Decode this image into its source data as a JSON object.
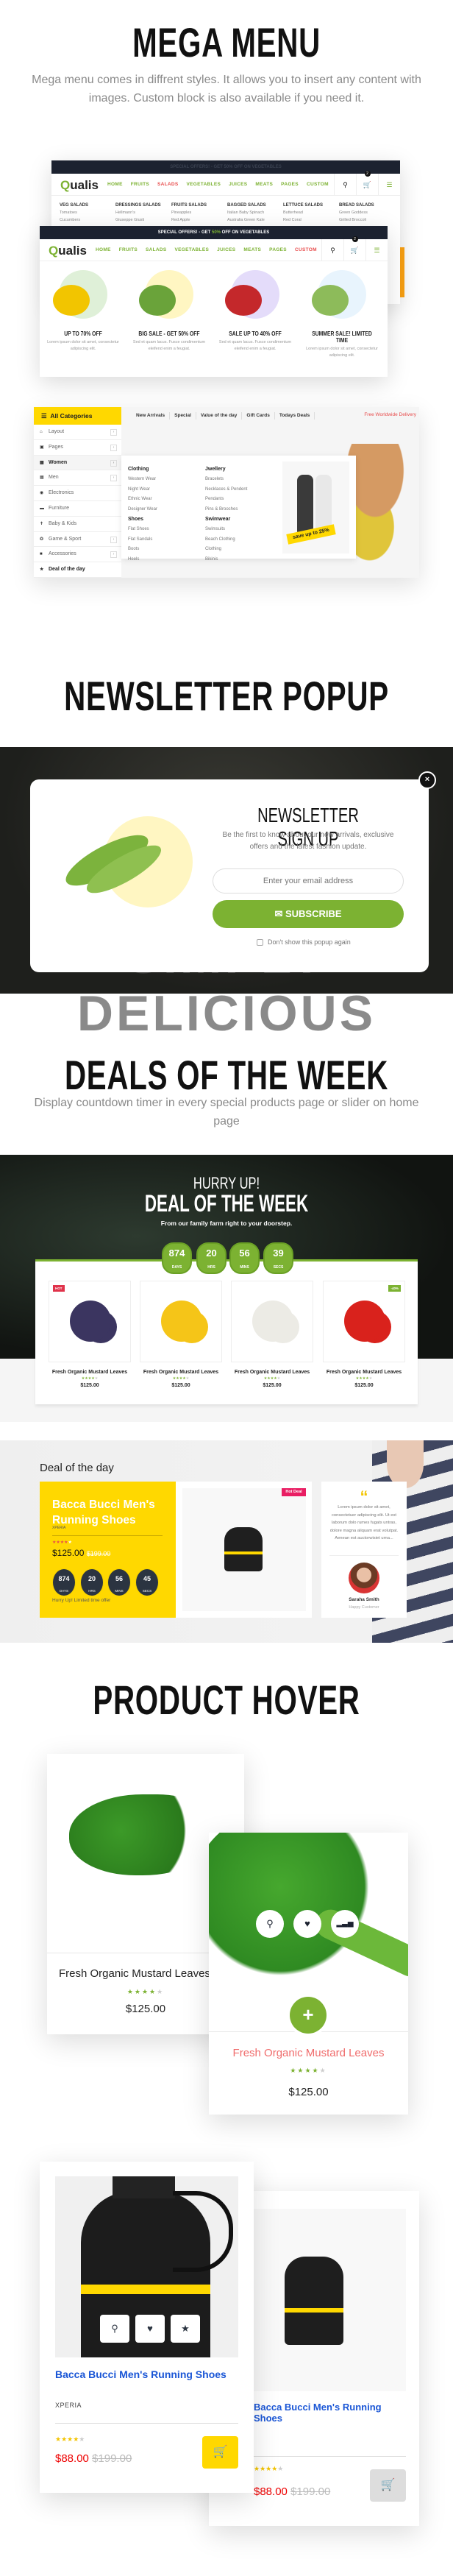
{
  "colors": {
    "accent_green": "#7cb232",
    "dark": "#1c2230",
    "yellow": "#ffd800",
    "red": "#e84c4c",
    "blue": "#1a56d6",
    "pink": "#e91e63"
  },
  "mega_menu": {
    "title": "MEGA MENU",
    "subtitle": "Mega menu comes in diffrent styles. It allows you to insert any content with images. Custom block is also available if you need it.",
    "back_window": {
      "offer_bar": "SPECIAL OFFERS! - GET 50% OFF ON VEGETABLES",
      "logo": "Qualis",
      "nav": [
        "HOME",
        "FRUITS",
        "SALADS",
        "VEGETABLES",
        "JUICES",
        "MEATS",
        "PAGES",
        "CUSTOM"
      ],
      "active_nav": "SALADS",
      "cart_count": "2",
      "submenu": [
        {
          "heading": "VEG SALADS",
          "items": [
            "Tomatoes",
            "Cucumbers"
          ]
        },
        {
          "heading": "DRESSINGS SALADS",
          "items": [
            "Hellmann's",
            "Giuseppe Giusti"
          ]
        },
        {
          "heading": "FRUITS SALADS",
          "items": [
            "Pineapples",
            "Red Apple"
          ]
        },
        {
          "heading": "BAGGED SALADS",
          "items": [
            "Italian Baby Spinach",
            "Australia Green Kale"
          ]
        },
        {
          "heading": "LETTUCE SALADS",
          "items": [
            "Butterhead",
            "Red Coral"
          ]
        },
        {
          "heading": "BREAD SALADS",
          "items": [
            "Green Goddess",
            "Grilled Broccoli"
          ]
        }
      ]
    },
    "front_window": {
      "offer_prefix": "SPECIAL OFFERS! - GET ",
      "offer_highlight": "50%",
      "offer_suffix": " OFF ON VEGETABLES",
      "logo": "Qualis",
      "nav": [
        "HOME",
        "FRUITS",
        "SALADS",
        "VEGETABLES",
        "JUICES",
        "MEATS",
        "PAGES",
        "CUSTOM"
      ],
      "active_nav": "CUSTOM",
      "cart_count": "2",
      "promos": [
        {
          "title": "UP TO 70% OFF",
          "desc": "Lorem ipsum dolor sit amet, consectetur adipiscing elit.",
          "circle": "#dff0d8",
          "fruit": "#f2c500"
        },
        {
          "title": "BIG SALE - GET 50% OFF",
          "desc": "Sed et quam lacus. Fusce condimentum eleifend enim a feugiat.",
          "circle": "#fff6c2",
          "fruit": "#6aa33a"
        },
        {
          "title": "SALE UP TO 40% OFF",
          "desc": "Sed et quam lacus. Fusce condimentum eleifend enim a feugiat.",
          "circle": "#e4dcfa",
          "fruit": "#c4282b"
        },
        {
          "title": "SUMMER SALE! LIMITED TIME",
          "desc": "Lorem ipsum dolor sit amet, consectetur adipiscing elit.",
          "circle": "#e8f4fd",
          "fruit": "#8dbb5a"
        }
      ]
    },
    "categories": {
      "header": "All Categories",
      "items": [
        {
          "label": "Layout",
          "icon": "home-icon",
          "arrow": true
        },
        {
          "label": "Pages",
          "icon": "file-icon",
          "arrow": true
        },
        {
          "label": "Women",
          "icon": "gift-icon",
          "arrow": true,
          "active": true
        },
        {
          "label": "Men",
          "icon": "briefcase-icon",
          "arrow": true
        },
        {
          "label": "Electronics",
          "icon": "camera-icon",
          "arrow": false
        },
        {
          "label": "Furniture",
          "icon": "bed-icon",
          "arrow": false
        },
        {
          "label": "Baby & Kids",
          "icon": "child-icon",
          "arrow": false
        },
        {
          "label": "Game & Sport",
          "icon": "ball-icon",
          "arrow": true
        },
        {
          "label": "Accessories",
          "icon": "tablet-icon",
          "arrow": true
        },
        {
          "label": "Deal of the day",
          "icon": "star-icon",
          "arrow": false,
          "bold": true
        }
      ],
      "top_nav": [
        "New Arrivals",
        "Special",
        "Value of the day",
        "Gift Cards",
        "Todays Deals"
      ],
      "delivery": "Free Worldwide Delivery",
      "dropdown": [
        {
          "heading": "Clothing",
          "items": [
            "Western Wear",
            "Night Wear",
            "Ethnic Wear",
            "Designer Wear"
          ]
        },
        {
          "heading": "Jwellery",
          "items": [
            "Bracelets",
            "Necklaces & Pendent",
            "Pendants",
            "Pins & Brooches"
          ]
        },
        {
          "heading": "Shoes",
          "items": [
            "Flat Shoes",
            "Flat Sandals",
            "Boots",
            "Heels"
          ]
        },
        {
          "heading": "Swimwear",
          "items": [
            "Swimsuits",
            "Beach Clothing",
            "Clothing",
            "Bikinis"
          ]
        }
      ],
      "banner": "save up to 25%"
    }
  },
  "newsletter": {
    "title": "NEWSLETTER POPUP",
    "bg_text": "SIMPLY DELICIOUS",
    "popup_title": "NEWSLETTER SIGN UP",
    "popup_text": "Be the first to know about our new arrivals, exclusive offers and the latest fashion update.",
    "email_placeholder": "Enter your email address",
    "subscribe": "SUBSCRIBE",
    "dont_show": "Don't show this popup again",
    "dont_show_checked": false
  },
  "deals": {
    "title": "DEALS OF THE WEEK",
    "subtitle": "Display countdown timer in every special products page or slider on home page",
    "banner": {
      "hurry": "HURRY UP!",
      "heading": "DEAL OF THE WEEK",
      "tagline": "From our family farm right to your doorstep.",
      "timer": [
        {
          "v": "874",
          "u": "DAYS"
        },
        {
          "v": "20",
          "u": "HRS"
        },
        {
          "v": "56",
          "u": "MINS"
        },
        {
          "v": "39",
          "u": "SECS"
        }
      ],
      "products": [
        {
          "name": "Fresh Organic Mustard Leaves",
          "price": "$125.00",
          "rating": 4,
          "badge": "HOT",
          "fruit": "#3b3560"
        },
        {
          "name": "Fresh Organic Mustard Leaves",
          "price": "$125.00",
          "rating": 4,
          "badge": "",
          "fruit": "#f5c518"
        },
        {
          "name": "Fresh Organic Mustard Leaves",
          "price": "$125.00",
          "rating": 4,
          "badge": "",
          "fruit": "#ecebe5"
        },
        {
          "name": "Fresh Organic Mustard Leaves",
          "price": "$125.00",
          "rating": 4,
          "badge": "-40%",
          "fruit": "#d9221c"
        }
      ]
    },
    "deal_of_day": {
      "heading": "Deal of the day",
      "product": "Bacca Bucci Men's Running Shoes",
      "brand": "XPERIA",
      "rating": 4,
      "price": "$125.00",
      "old_price": "$199.00",
      "timer": [
        {
          "v": "874",
          "u": "DAYS"
        },
        {
          "v": "20",
          "u": "HRS"
        },
        {
          "v": "56",
          "u": "MINS"
        },
        {
          "v": "45",
          "u": "SECS"
        }
      ],
      "hurry": "Hurry Up! Limited time offer",
      "badge": "Hot Deal",
      "testimonial": {
        "text": "Lorem ipsum dolor sit amet, consectetuer adipiscing elit. Ut est laborum dolo rumes fugats untras, dolore magna aliquam erat volutpat. Aenean est auctorwisiet urna...",
        "name": "Saraha Smith",
        "role": "Happy Customer"
      }
    }
  },
  "product_hover": {
    "title": "PRODUCT HOVER",
    "card_a": {
      "name": "Fresh Organic Mustard Leaves",
      "price": "$125.00",
      "rating": 4
    },
    "card_b": {
      "name": "Fresh Organic Mustard Leaves",
      "price": "$125.00",
      "rating": 4
    },
    "card_c": {
      "name": "Bacca Bucci Men's Running Shoes",
      "brand": "XPERIA",
      "price": "$88.00",
      "old_price": "$199.00",
      "rating": 4
    },
    "card_d": {
      "name": "Bacca Bucci Men's Running Shoes",
      "price": "$88.00",
      "old_price": "$199.00",
      "rating": 4
    }
  }
}
